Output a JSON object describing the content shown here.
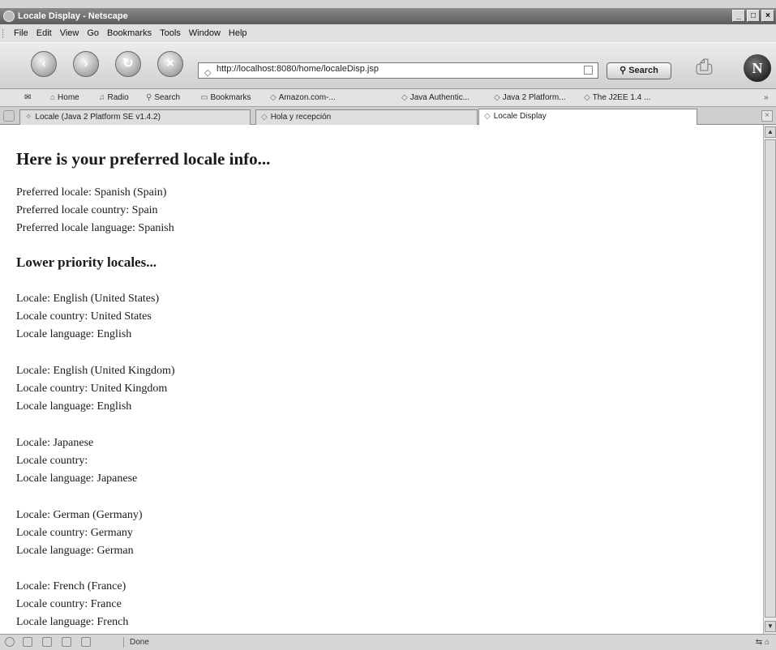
{
  "window": {
    "title": "Locale Display - Netscape"
  },
  "menu": [
    "File",
    "Edit",
    "View",
    "Go",
    "Bookmarks",
    "Tools",
    "Window",
    "Help"
  ],
  "nav": {
    "url": "http://localhost:8080/home/localeDisp.jsp",
    "search_label": "Search"
  },
  "personal_toolbar": [
    "Home",
    "Radio",
    "Search",
    "Bookmarks",
    "Amazon.com-...",
    "Java Authentic...",
    "Java 2 Platform...",
    "The J2EE 1.4 ..."
  ],
  "tabs": [
    {
      "label": "Locale (Java 2 Platform SE v1.4.2)"
    },
    {
      "label": "Hola y recepción"
    },
    {
      "label": "Locale Display"
    }
  ],
  "page": {
    "heading": "Here is your preferred locale info...",
    "preferred": [
      "Preferred locale: Spanish (Spain)",
      "Preferred locale country: Spain",
      "Preferred locale language: Spanish"
    ],
    "subheading": "Lower priority locales...",
    "locales": [
      [
        "Locale: English (United States)",
        "Locale country: United States",
        "Locale language: English"
      ],
      [
        "Locale: English (United Kingdom)",
        "Locale country: United Kingdom",
        "Locale language: English"
      ],
      [
        "Locale: Japanese",
        "Locale country:",
        "Locale language: Japanese"
      ],
      [
        "Locale: German (Germany)",
        "Locale country: Germany",
        "Locale language: German"
      ],
      [
        "Locale: French (France)",
        "Locale country: France",
        "Locale language: French"
      ]
    ]
  },
  "status": {
    "text": "Done"
  }
}
